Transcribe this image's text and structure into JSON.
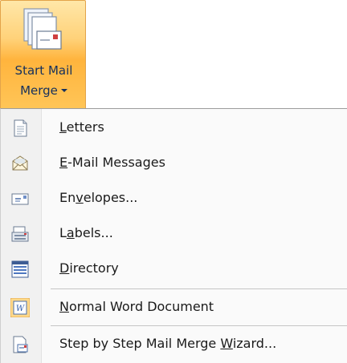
{
  "ribbon": {
    "button_label_line1": "Start Mail",
    "button_label_line2": "Merge",
    "icon": "start-mail-merge-icon"
  },
  "menu": {
    "items": [
      {
        "label": "Letters",
        "icon": "letter-document-icon",
        "mnemonic_index": 0
      },
      {
        "label": "E-Mail Messages",
        "icon": "email-envelope-icon",
        "mnemonic_index": 0
      },
      {
        "label": "Envelopes...",
        "icon": "envelope-icon",
        "mnemonic_index": 2
      },
      {
        "label": "Labels...",
        "icon": "labels-icon",
        "mnemonic_index": 1
      },
      {
        "label": "Directory",
        "icon": "directory-icon",
        "mnemonic_index": 0
      },
      {
        "label": "Normal Word Document",
        "icon": "word-document-icon",
        "mnemonic_index": 0
      },
      {
        "label": "Step by Step Mail Merge Wizard...",
        "icon": "mail-merge-wizard-icon",
        "mnemonic_index": 24
      }
    ]
  }
}
